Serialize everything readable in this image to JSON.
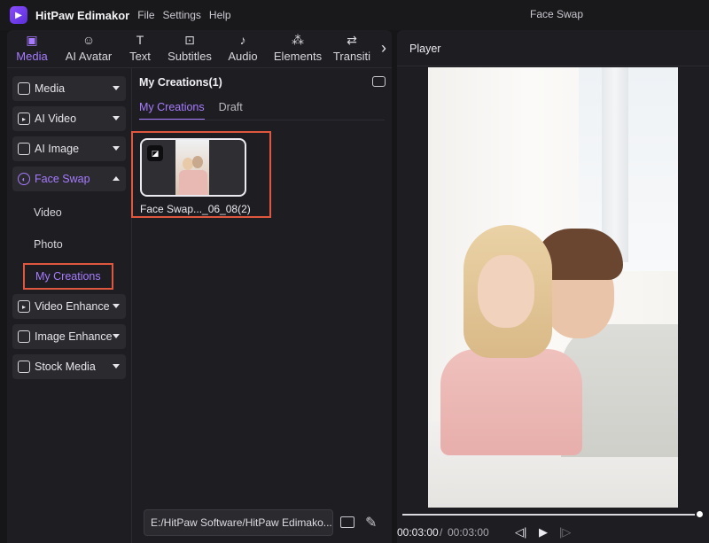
{
  "app": {
    "name": "HitPaw Edimakor",
    "menu": [
      "File",
      "Settings",
      "Help"
    ],
    "window_title": "Face Swap"
  },
  "toolbar": {
    "tabs": [
      {
        "label": "Media",
        "icon": "media-icon",
        "active": true
      },
      {
        "label": "AI Avatar",
        "icon": "avatar-icon",
        "active": false
      },
      {
        "label": "Text",
        "icon": "text-icon",
        "active": false
      },
      {
        "label": "Subtitles",
        "icon": "subtitles-icon",
        "active": false
      },
      {
        "label": "Audio",
        "icon": "audio-icon",
        "active": false
      },
      {
        "label": "Elements",
        "icon": "elements-icon",
        "active": false
      },
      {
        "label": "Transiti",
        "icon": "transition-icon",
        "active": false
      }
    ]
  },
  "sidebar": {
    "items": [
      {
        "label": "Media",
        "icon": "media-icon"
      },
      {
        "label": "AI Video",
        "icon": "ai-video-icon"
      },
      {
        "label": "AI Image",
        "icon": "ai-image-icon"
      },
      {
        "label": "Face Swap",
        "icon": "face-swap-icon",
        "expanded": true
      },
      {
        "label": "Video Enhance",
        "icon": "video-enhance-icon"
      },
      {
        "label": "Image Enhance",
        "icon": "image-enhance-icon"
      },
      {
        "label": "Stock Media",
        "icon": "stock-media-icon"
      }
    ],
    "face_swap_subitems": [
      "Video",
      "Photo",
      "My Creations"
    ]
  },
  "content": {
    "title": "My Creations(1)",
    "tabs": [
      "My Creations",
      "Draft"
    ],
    "active_tab": "My Creations",
    "items": [
      {
        "label": "Face Swap..._06_08(2)"
      }
    ],
    "path": "E:/HitPaw Software/HitPaw Edimako..."
  },
  "player": {
    "title": "Player",
    "time_current": "00:03:00",
    "time_separator": "/",
    "time_total": "00:03:00",
    "progress": 1.0
  },
  "colors": {
    "accent": "#a77bff",
    "highlight": "#e0573f",
    "background": "#161619",
    "panel": "#1e1e22"
  }
}
